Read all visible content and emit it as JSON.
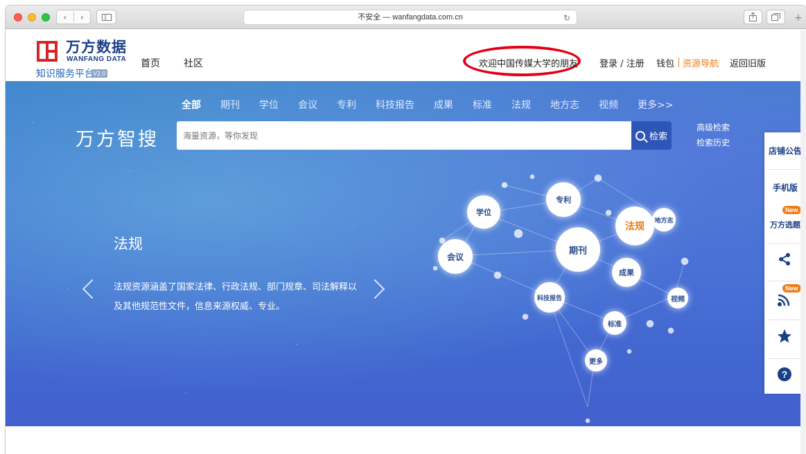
{
  "browser": {
    "address": "不安全 — wanfangdata.com.cn"
  },
  "header": {
    "logo_cn": "万方数据",
    "logo_en": "WANFANG DATA",
    "logo_sub": "知识服务平台",
    "logo_version": "V2.0",
    "nav": [
      "首页",
      "社区"
    ],
    "welcome": "欢迎中国传媒大学的朋友",
    "login": "登录 / 注册",
    "wallet": "钱包",
    "resource_nav": "资源导航",
    "old_version": "返回旧版"
  },
  "search": {
    "categories": [
      "全部",
      "期刊",
      "学位",
      "会议",
      "专利",
      "科技报告",
      "成果",
      "标准",
      "法规",
      "地方志",
      "视频",
      "更多>>"
    ],
    "brand": "万方智搜",
    "placeholder": "海量资源，等你发现",
    "button": "检索",
    "advanced": "高级检索",
    "history": "检索历史"
  },
  "slide": {
    "title": "法规",
    "description": "法规资源涵盖了国家法律、行政法规、部门规章、司法解释以及其他规范性文件，信息来源权威、专业。"
  },
  "brain_nodes": [
    "学位",
    "专利",
    "法规",
    "地方志",
    "会议",
    "期刊",
    "成果",
    "科技报告",
    "视频",
    "标准",
    "更多"
  ],
  "side_toolbar": {
    "notice": "店铺公告",
    "mobile": "手机版",
    "topic": "万方选题",
    "new_badge": "New",
    "icons": [
      "share-nodes-icon",
      "rss-icon",
      "star-icon",
      "help-icon"
    ]
  },
  "colors": {
    "brand_red": "#d32626",
    "brand_blue": "#1b3f87",
    "accent_orange": "#f07b14",
    "search_button": "#2e56b8",
    "highlight_circle": "#e40014"
  }
}
